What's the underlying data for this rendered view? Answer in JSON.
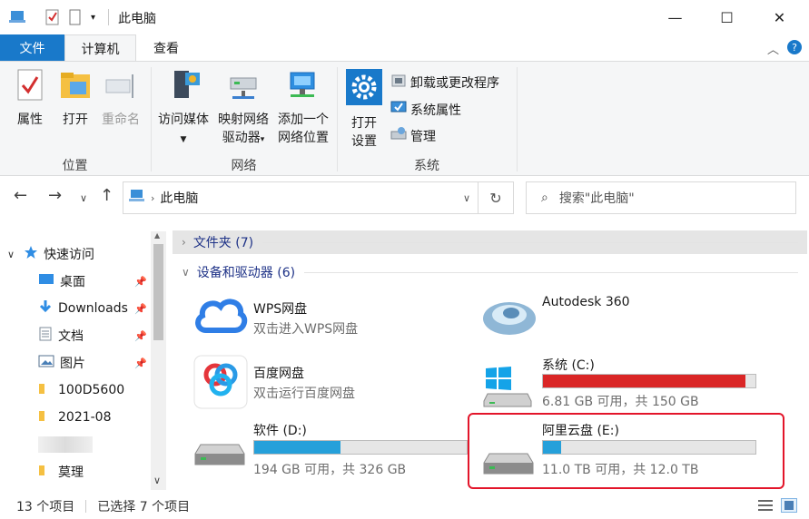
{
  "window": {
    "title": "此电脑",
    "minimize_glyph": "—",
    "maximize_glyph": "☐",
    "close_glyph": "✕"
  },
  "tabs": {
    "file": "文件",
    "computer": "计算机",
    "view": "查看"
  },
  "ribbon": {
    "location": {
      "label": "位置",
      "properties": "属性",
      "open": "打开",
      "rename": "重命名"
    },
    "network": {
      "label": "网络",
      "access_media_1": "访问媒体",
      "map_drive_1": "映射网络",
      "map_drive_2": "驱动器",
      "add_location_1": "添加一个",
      "add_location_2": "网络位置"
    },
    "system": {
      "label": "系统",
      "open_settings_1": "打开",
      "open_settings_2": "设置",
      "uninstall": "卸载或更改程序",
      "system_properties": "系统属性",
      "manage": "管理"
    }
  },
  "address": {
    "crumb": "此电脑",
    "search_placeholder": "搜索\"此电脑\""
  },
  "navpane": {
    "quick_access": "快速访问",
    "items": [
      {
        "label": "桌面",
        "pinned": true
      },
      {
        "label": "Downloads",
        "pinned": true
      },
      {
        "label": "文档",
        "pinned": true
      },
      {
        "label": "图片",
        "pinned": true
      },
      {
        "label": "100D5600",
        "pinned": false
      },
      {
        "label": "2021-08",
        "pinned": false
      },
      {
        "label": "",
        "pinned": false
      },
      {
        "label": "莫理",
        "pinned": false
      }
    ]
  },
  "content": {
    "folders_group": "文件夹 (7)",
    "devices_group": "设备和驱动器 (6)",
    "devices": [
      {
        "name": "WPS网盘",
        "sub": "双击进入WPS网盘"
      },
      {
        "name": "Autodesk 360"
      },
      {
        "name": "百度网盘",
        "sub": "双击运行百度网盘"
      },
      {
        "name": "系统 (C:)",
        "info": "6.81 GB 可用，共 150 GB",
        "used_fraction": 0.955
      },
      {
        "name": "软件 (D:)",
        "info": "194 GB 可用，共 326 GB",
        "used_fraction": 0.405
      },
      {
        "name": "阿里云盘 (E:)",
        "info": "11.0 TB 可用，共 12.0 TB",
        "used_fraction": 0.085
      }
    ]
  },
  "statusbar": {
    "count": "13 个项目",
    "selected": "已选择 7 个项目"
  },
  "colors": {
    "accent": "#1979ca",
    "drive_bar": "#26a0da",
    "drive_bar_low": "#da2626",
    "highlight": "#e3152a"
  }
}
